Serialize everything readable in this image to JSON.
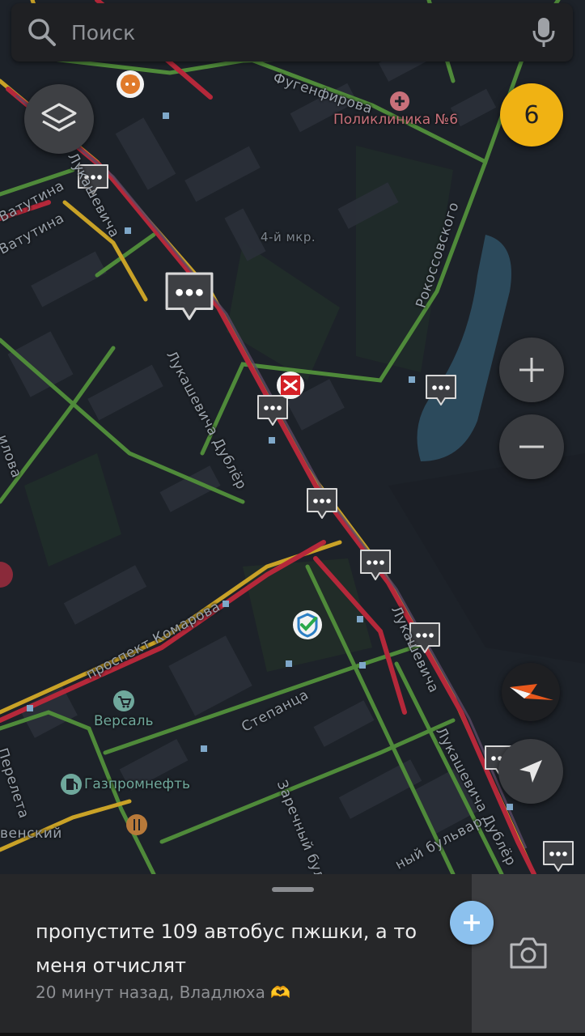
{
  "search": {
    "placeholder": "Поиск"
  },
  "traffic": {
    "score": "6"
  },
  "map": {
    "streets": [
      {
        "name": "Фугенфирова"
      },
      {
        "name": "Рокоссовского"
      },
      {
        "name": "Ватутина"
      },
      {
        "name": "Ватутина"
      },
      {
        "name": "Лукашевича"
      },
      {
        "name": "Лукашевича Дублёр"
      },
      {
        "name": "проспект Комарова"
      },
      {
        "name": "Степанца"
      },
      {
        "name": "Заречный бульвар"
      },
      {
        "name": "Лукашевича"
      },
      {
        "name": "Лукашевича Дублёр"
      },
      {
        "name": "Перелета"
      },
      {
        "name": "венский"
      },
      {
        "name": "ный бульвар"
      },
      {
        "name": "илова"
      }
    ],
    "district_label": "4-й мкр.",
    "pois": [
      {
        "name": "Поликлиника №6",
        "color": "#c8707a",
        "icon": "medical-cross-icon"
      },
      {
        "name": "Версаль",
        "color": "#6fa89c",
        "icon": "shopping-cart-icon"
      },
      {
        "name": "Газпромнефть",
        "color": "#6fa89c",
        "icon": "fuel-icon"
      }
    ]
  },
  "message": {
    "text": "пропустите 109 автобус пжшки, а то меня отчислят",
    "meta": "20 минут назад, Владлюха 🫶"
  },
  "colors": {
    "map_background": "#1d2229",
    "traffic_red": "#b5283a",
    "traffic_yellow": "#c9a227",
    "traffic_green": "#4f8a3a",
    "water": "#2c4a5c",
    "score_badge": "#f0b213",
    "add_button": "#8cc1ee"
  }
}
